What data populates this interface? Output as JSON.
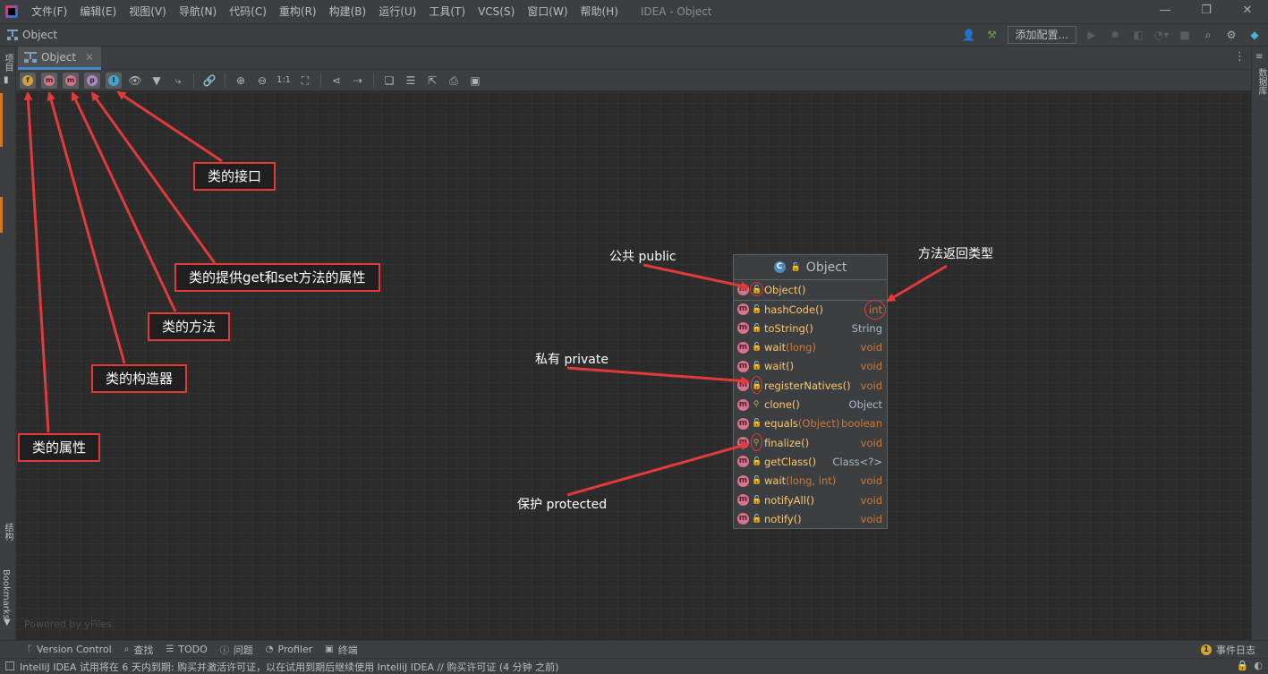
{
  "menu": {
    "items": [
      "文件(F)",
      "编辑(E)",
      "视图(V)",
      "导航(N)",
      "代码(C)",
      "重构(R)",
      "构建(B)",
      "运行(U)",
      "工具(T)",
      "VCS(S)",
      "窗口(W)",
      "帮助(H)"
    ],
    "window_title": "IDEA - Object"
  },
  "navbar": {
    "breadcrumb": "Object",
    "config_button": "添加配置..."
  },
  "left_strip": {
    "project_label": "项目",
    "structure_label": "结构",
    "bookmarks_label": "Bookmarks"
  },
  "right_strip": {
    "database_label": "数据库"
  },
  "editor": {
    "tab_label": "Object"
  },
  "toolbar": {
    "toggles": [
      {
        "letter": "f",
        "color": "#d3a03b"
      },
      {
        "letter": "m",
        "color": "#d9738a"
      },
      {
        "letter": "m",
        "color": "#d9738a"
      },
      {
        "letter": "p",
        "color": "#b187c2"
      },
      {
        "letter": "I",
        "color": "#40a6c9"
      }
    ],
    "zoom_reset": "1:1"
  },
  "canvas": {
    "watermark": "Powered by yFiles"
  },
  "uml": {
    "class_name": "Object",
    "constructor": {
      "name": "Object()",
      "visibility": "public"
    },
    "members": [
      {
        "name": "hashCode",
        "params": "()",
        "type": "int",
        "visibility": "public"
      },
      {
        "name": "toString",
        "params": "()",
        "type": "String",
        "visibility": "public"
      },
      {
        "name": "wait",
        "params": "(long)",
        "type": "void",
        "visibility": "public"
      },
      {
        "name": "wait",
        "params": "()",
        "type": "void",
        "visibility": "public"
      },
      {
        "name": "registerNatives",
        "params": "()",
        "type": "void",
        "visibility": "private"
      },
      {
        "name": "clone",
        "params": "()",
        "type": "Object",
        "visibility": "protected"
      },
      {
        "name": "equals",
        "params": "(Object)",
        "type": "boolean",
        "visibility": "public"
      },
      {
        "name": "finalize",
        "params": "()",
        "type": "void",
        "visibility": "protected"
      },
      {
        "name": "getClass",
        "params": "()",
        "type": "Class<?>",
        "visibility": "public"
      },
      {
        "name": "wait",
        "params": "(long, int)",
        "type": "void",
        "visibility": "public"
      },
      {
        "name": "notifyAll",
        "params": "()",
        "type": "void",
        "visibility": "public"
      },
      {
        "name": "notify",
        "params": "()",
        "type": "void",
        "visibility": "public"
      }
    ]
  },
  "annotations": {
    "interface": "类的接口",
    "property": "类的提供get和set方法的属性",
    "method": "类的方法",
    "constructor": "类的构造器",
    "field": "类的属性",
    "public": "公共 public",
    "return_type": "方法返回类型",
    "private": "私有 private",
    "protected": "保护 protected"
  },
  "bottom_bar": {
    "version_control": "Version Control",
    "find": "查找",
    "todo": "TODO",
    "problems": "问题",
    "profiler": "Profiler",
    "terminal": "终端",
    "event_count": "1",
    "event_log": "事件日志"
  },
  "status": {
    "message": "IntelliJ IDEA 试用将在 6 天内到期: 购买并激活许可证，以在试用到期后继续使用 IntelliJ IDEA // 购买许可证 (4 分钟 之前)"
  },
  "colors": {
    "accent": "#4a88c7",
    "annotation_red": "#e03a3a",
    "method_name": "#ffc66d",
    "type_keyword": "#cc7832"
  }
}
